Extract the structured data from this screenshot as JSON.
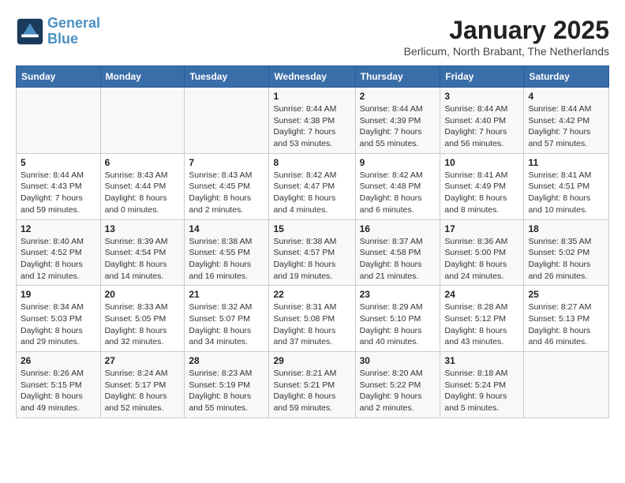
{
  "logo": {
    "line1": "General",
    "line2": "Blue"
  },
  "title": "January 2025",
  "subtitle": "Berlicum, North Brabant, The Netherlands",
  "days_of_week": [
    "Sunday",
    "Monday",
    "Tuesday",
    "Wednesday",
    "Thursday",
    "Friday",
    "Saturday"
  ],
  "weeks": [
    [
      {
        "day": "",
        "info": ""
      },
      {
        "day": "",
        "info": ""
      },
      {
        "day": "",
        "info": ""
      },
      {
        "day": "1",
        "info": "Sunrise: 8:44 AM\nSunset: 4:38 PM\nDaylight: 7 hours and 53 minutes."
      },
      {
        "day": "2",
        "info": "Sunrise: 8:44 AM\nSunset: 4:39 PM\nDaylight: 7 hours and 55 minutes."
      },
      {
        "day": "3",
        "info": "Sunrise: 8:44 AM\nSunset: 4:40 PM\nDaylight: 7 hours and 56 minutes."
      },
      {
        "day": "4",
        "info": "Sunrise: 8:44 AM\nSunset: 4:42 PM\nDaylight: 7 hours and 57 minutes."
      }
    ],
    [
      {
        "day": "5",
        "info": "Sunrise: 8:44 AM\nSunset: 4:43 PM\nDaylight: 7 hours and 59 minutes."
      },
      {
        "day": "6",
        "info": "Sunrise: 8:43 AM\nSunset: 4:44 PM\nDaylight: 8 hours and 0 minutes."
      },
      {
        "day": "7",
        "info": "Sunrise: 8:43 AM\nSunset: 4:45 PM\nDaylight: 8 hours and 2 minutes."
      },
      {
        "day": "8",
        "info": "Sunrise: 8:42 AM\nSunset: 4:47 PM\nDaylight: 8 hours and 4 minutes."
      },
      {
        "day": "9",
        "info": "Sunrise: 8:42 AM\nSunset: 4:48 PM\nDaylight: 8 hours and 6 minutes."
      },
      {
        "day": "10",
        "info": "Sunrise: 8:41 AM\nSunset: 4:49 PM\nDaylight: 8 hours and 8 minutes."
      },
      {
        "day": "11",
        "info": "Sunrise: 8:41 AM\nSunset: 4:51 PM\nDaylight: 8 hours and 10 minutes."
      }
    ],
    [
      {
        "day": "12",
        "info": "Sunrise: 8:40 AM\nSunset: 4:52 PM\nDaylight: 8 hours and 12 minutes."
      },
      {
        "day": "13",
        "info": "Sunrise: 8:39 AM\nSunset: 4:54 PM\nDaylight: 8 hours and 14 minutes."
      },
      {
        "day": "14",
        "info": "Sunrise: 8:38 AM\nSunset: 4:55 PM\nDaylight: 8 hours and 16 minutes."
      },
      {
        "day": "15",
        "info": "Sunrise: 8:38 AM\nSunset: 4:57 PM\nDaylight: 8 hours and 19 minutes."
      },
      {
        "day": "16",
        "info": "Sunrise: 8:37 AM\nSunset: 4:58 PM\nDaylight: 8 hours and 21 minutes."
      },
      {
        "day": "17",
        "info": "Sunrise: 8:36 AM\nSunset: 5:00 PM\nDaylight: 8 hours and 24 minutes."
      },
      {
        "day": "18",
        "info": "Sunrise: 8:35 AM\nSunset: 5:02 PM\nDaylight: 8 hours and 26 minutes."
      }
    ],
    [
      {
        "day": "19",
        "info": "Sunrise: 8:34 AM\nSunset: 5:03 PM\nDaylight: 8 hours and 29 minutes."
      },
      {
        "day": "20",
        "info": "Sunrise: 8:33 AM\nSunset: 5:05 PM\nDaylight: 8 hours and 32 minutes."
      },
      {
        "day": "21",
        "info": "Sunrise: 8:32 AM\nSunset: 5:07 PM\nDaylight: 8 hours and 34 minutes."
      },
      {
        "day": "22",
        "info": "Sunrise: 8:31 AM\nSunset: 5:08 PM\nDaylight: 8 hours and 37 minutes."
      },
      {
        "day": "23",
        "info": "Sunrise: 8:29 AM\nSunset: 5:10 PM\nDaylight: 8 hours and 40 minutes."
      },
      {
        "day": "24",
        "info": "Sunrise: 8:28 AM\nSunset: 5:12 PM\nDaylight: 8 hours and 43 minutes."
      },
      {
        "day": "25",
        "info": "Sunrise: 8:27 AM\nSunset: 5:13 PM\nDaylight: 8 hours and 46 minutes."
      }
    ],
    [
      {
        "day": "26",
        "info": "Sunrise: 8:26 AM\nSunset: 5:15 PM\nDaylight: 8 hours and 49 minutes."
      },
      {
        "day": "27",
        "info": "Sunrise: 8:24 AM\nSunset: 5:17 PM\nDaylight: 8 hours and 52 minutes."
      },
      {
        "day": "28",
        "info": "Sunrise: 8:23 AM\nSunset: 5:19 PM\nDaylight: 8 hours and 55 minutes."
      },
      {
        "day": "29",
        "info": "Sunrise: 8:21 AM\nSunset: 5:21 PM\nDaylight: 8 hours and 59 minutes."
      },
      {
        "day": "30",
        "info": "Sunrise: 8:20 AM\nSunset: 5:22 PM\nDaylight: 9 hours and 2 minutes."
      },
      {
        "day": "31",
        "info": "Sunrise: 8:18 AM\nSunset: 5:24 PM\nDaylight: 9 hours and 5 minutes."
      },
      {
        "day": "",
        "info": ""
      }
    ]
  ]
}
